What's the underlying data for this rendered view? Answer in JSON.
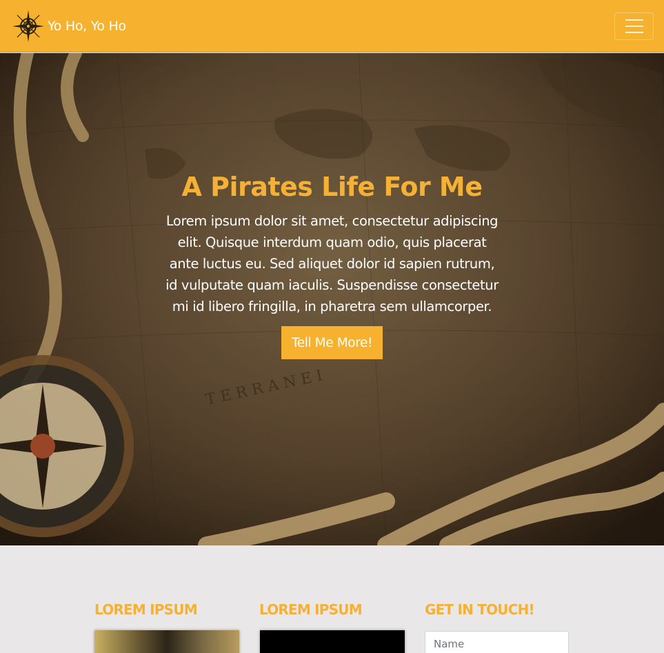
{
  "navbar": {
    "brand_text": "Yo Ho, Yo Ho",
    "logo_icon": "compass-rose-icon",
    "toggler_icon": "hamburger-menu-icon",
    "background_color": "#f6b12f"
  },
  "hero": {
    "title": "A Pirates Life For Me",
    "text": "Lorem ipsum dolor sit amet, consectetur adipiscing elit. Quisque interdum quam odio, quis placerat ante luctus eu. Sed aliquet dolor id sapien rutrum, id vulputate quam iaculis. Suspendisse consectetur mi id libero fringilla, in pharetra sem ullamcorper.",
    "button_label": "Tell Me More!",
    "accent_color": "#f5b136"
  },
  "sections": {
    "col1_heading": "LOREM IPSUM",
    "col2_heading": "LOREM IPSUM",
    "col3_heading": "GET IN TOUCH!",
    "name_placeholder": "Name"
  }
}
